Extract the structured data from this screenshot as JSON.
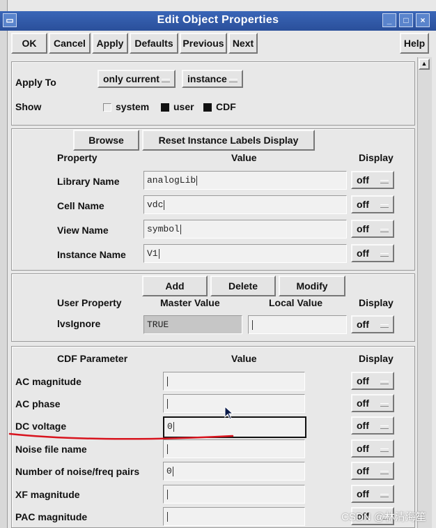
{
  "window": {
    "title": "Edit Object Properties",
    "min_glyph": "_",
    "max_glyph": "□",
    "close_glyph": "×"
  },
  "toolbar": {
    "ok": "OK",
    "cancel": "Cancel",
    "apply": "Apply",
    "defaults": "Defaults",
    "previous": "Previous",
    "next": "Next",
    "help": "Help"
  },
  "apply_section": {
    "apply_to_label": "Apply To",
    "apply_to_value": "only current",
    "apply_to_scope": "instance",
    "show_label": "Show",
    "system": "system",
    "user": "user",
    "cdf": "CDF"
  },
  "instance_section": {
    "browse": "Browse",
    "reset_labels": "Reset Instance Labels Display",
    "col_property": "Property",
    "col_value": "Value",
    "col_display": "Display",
    "rows": [
      {
        "label": "Library Name",
        "value": "analogLib",
        "display": "off"
      },
      {
        "label": "Cell Name",
        "value": "vdc",
        "display": "off"
      },
      {
        "label": "View Name",
        "value": "symbol",
        "display": "off"
      },
      {
        "label": "Instance Name",
        "value": "V1",
        "display": "off"
      }
    ]
  },
  "user_section": {
    "add": "Add",
    "delete": "Delete",
    "modify": "Modify",
    "col_user_property": "User Property",
    "col_master": "Master Value",
    "col_local": "Local Value",
    "col_display": "Display",
    "rows": [
      {
        "label": "lvsIgnore",
        "master": "TRUE",
        "local": "",
        "display": "off"
      }
    ]
  },
  "cdf_section": {
    "col_param": "CDF Parameter",
    "col_value": "Value",
    "col_display": "Display",
    "rows": [
      {
        "label": "AC magnitude",
        "value": "",
        "display": "off"
      },
      {
        "label": "AC phase",
        "value": "",
        "display": "off"
      },
      {
        "label": "DC voltage",
        "value": "0",
        "display": "off"
      },
      {
        "label": "Noise file name",
        "value": "",
        "display": "off"
      },
      {
        "label": "Number of noise/freq pairs",
        "value": "0",
        "display": "off"
      },
      {
        "label": "XF magnitude",
        "value": "",
        "display": "off"
      },
      {
        "label": "PAC magnitude",
        "value": "",
        "display": "off"
      }
    ]
  },
  "watermark": "CSDN @林清海笙",
  "colors": {
    "titlebar": "#2a4f9a",
    "annotation": "#d8141e"
  }
}
